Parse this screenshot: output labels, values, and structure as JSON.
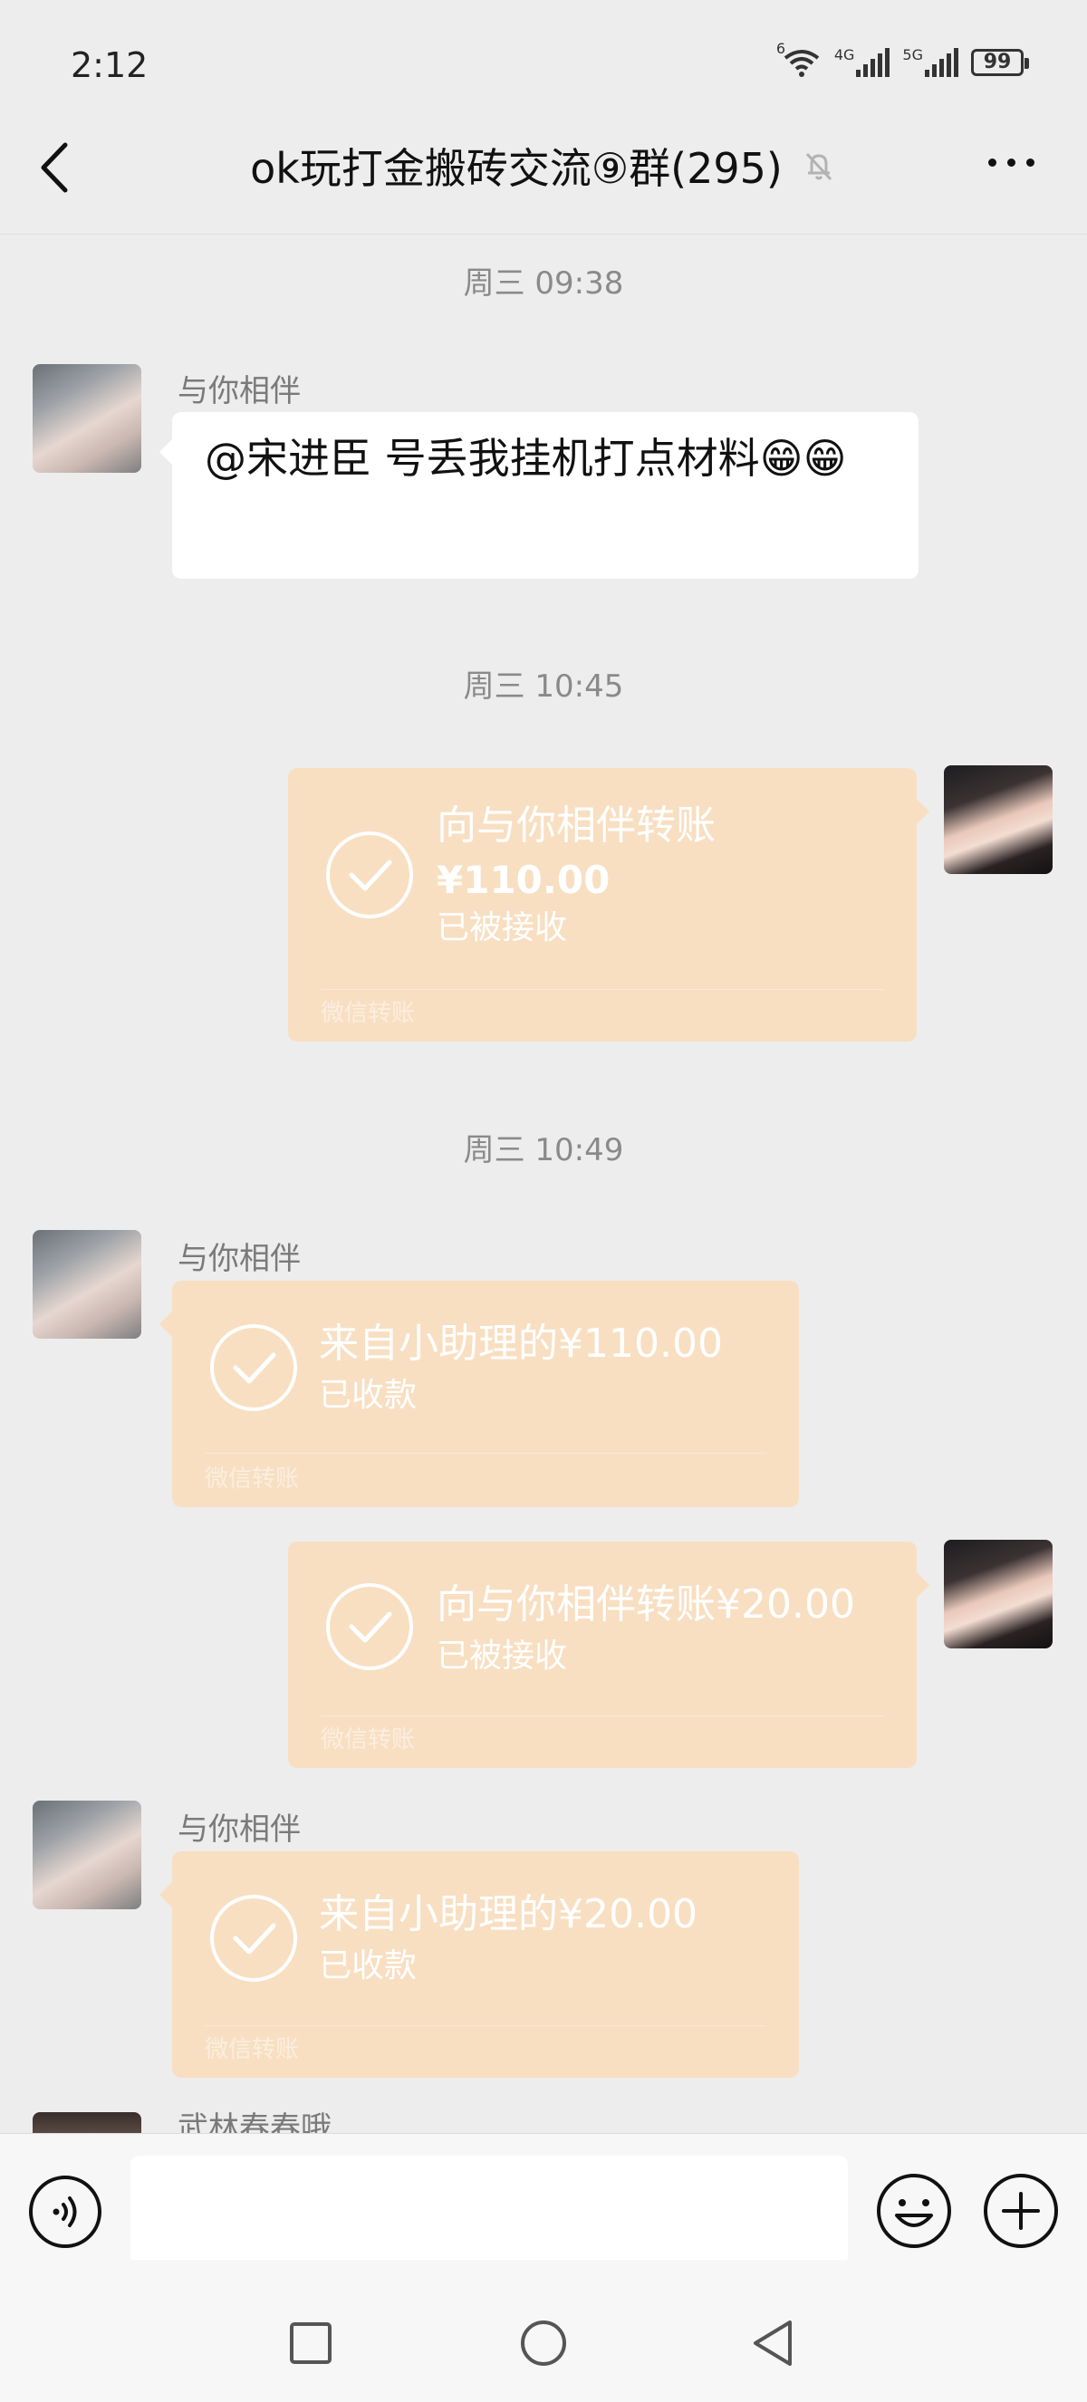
{
  "status_bar": {
    "time": "2:12",
    "wifi_label": "6",
    "net1_label": "4G",
    "net2_label": "5G",
    "battery": "99"
  },
  "header": {
    "title": "ok玩打金搬砖交流⑨群(295)"
  },
  "messages": {
    "ts1": "周三 09:38",
    "m1_sender": "与你相伴",
    "m1_text": "@宋进臣  号丢我挂机打点材料😁😁",
    "ts2": "周三 10:45",
    "t1_title": "向与你相伴转账",
    "t1_amount": "¥110.00",
    "t1_status": "已被接收",
    "t1_footer": "微信转账",
    "ts3": "周三 10:49",
    "m3_sender": "与你相伴",
    "t2_title": "来自小助理的¥110.00",
    "t2_status": "已收款",
    "t2_footer": "微信转账",
    "t3_title": "向与你相伴转账¥20.00",
    "t3_status": "已被接收",
    "t3_footer": "微信转账",
    "m5_sender": "与你相伴",
    "t4_title": "来自小助理的¥20.00",
    "t4_status": "已收款",
    "t4_footer": "微信转账",
    "peek_sender": "武林春春哦"
  },
  "input": {
    "value": ""
  },
  "colors": {
    "background": "#ededed",
    "transfer_bubble": "#f8dfc2",
    "text_bubble": "#ffffff"
  }
}
